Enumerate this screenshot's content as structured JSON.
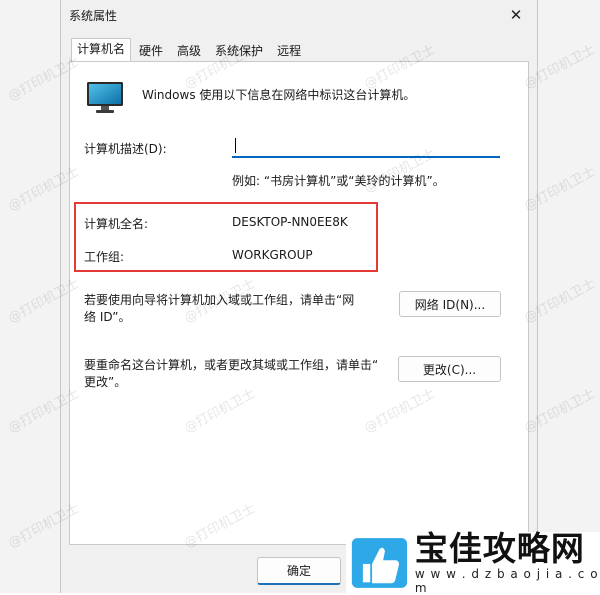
{
  "window": {
    "title": "系统属性",
    "close_glyph": "✕"
  },
  "tabs": [
    {
      "label": "计算机名",
      "active": true
    },
    {
      "label": "硬件",
      "active": false
    },
    {
      "label": "高级",
      "active": false
    },
    {
      "label": "系统保护",
      "active": false
    },
    {
      "label": "远程",
      "active": false
    }
  ],
  "intro": {
    "text": "Windows 使用以下信息在网络中标识这台计算机。",
    "icon": "monitor-icon"
  },
  "description": {
    "label": "计算机描述(D):",
    "value": "",
    "example": "例如: “书房计算机”或“美玲的计算机”。"
  },
  "full_name": {
    "label": "计算机全名:",
    "value": "DESKTOP-NN0EE8K"
  },
  "workgroup": {
    "label": "工作组:",
    "value": "WORKGROUP"
  },
  "network_id": {
    "text_line1": "若要使用向导将计算机加入域或工作组，请单击“网",
    "text_line2": "络 ID”。",
    "button": "网络 ID(N)..."
  },
  "rename": {
    "text_line1": "要重命名这台计算机，或者更改其域或工作组，请单击“",
    "text_line2": "更改”。",
    "button": "更改(C)..."
  },
  "footer": {
    "ok_button": "确定"
  },
  "watermark": {
    "text": "@打印机卫士"
  },
  "logo": {
    "main": "宝佳攻略网",
    "sub": "w w w . d z b a o j i a . c o m"
  },
  "colors": {
    "highlight": "#e53935",
    "accent": "#0067c0"
  }
}
